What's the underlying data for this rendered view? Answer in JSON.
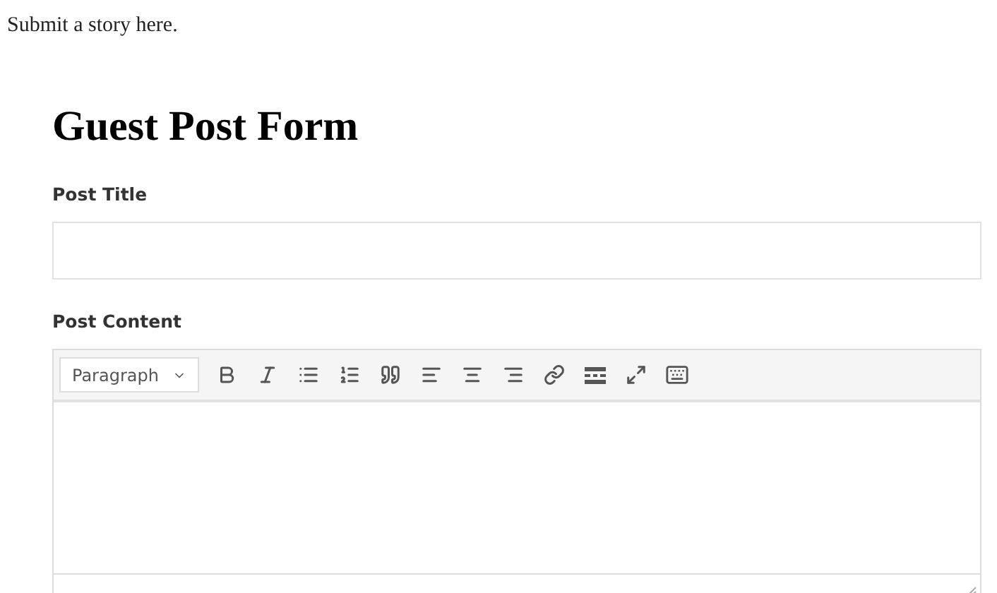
{
  "intro": "Submit a story here.",
  "form": {
    "title": "Guest Post Form",
    "fields": [
      {
        "label": "Post Title",
        "kind": "text"
      },
      {
        "label": "Post Content",
        "kind": "editor",
        "format": "Paragraph"
      }
    ]
  }
}
